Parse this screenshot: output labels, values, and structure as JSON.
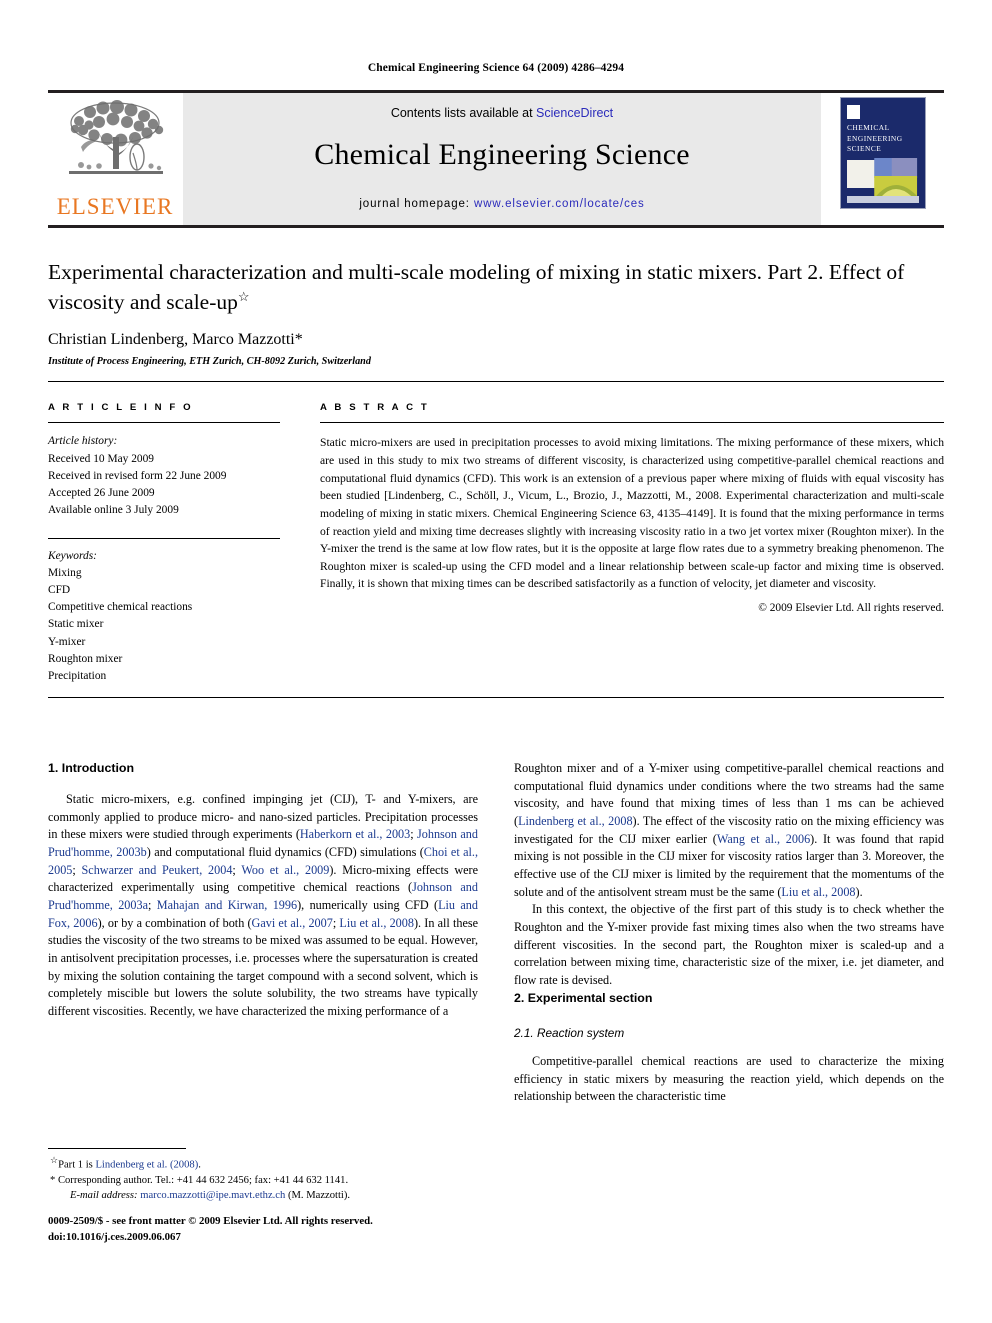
{
  "running_head": "Chemical Engineering Science 64 (2009) 4286–4294",
  "masthead": {
    "contents_prefix": "Contents lists available at ",
    "sciencedirect": "ScienceDirect",
    "journal_title": "Chemical Engineering Science",
    "homepage_prefix": "journal homepage: ",
    "homepage_url": "www.elsevier.com/locate/ces",
    "publisher_wordmark": "ELSEVIER",
    "cover_title_lines": [
      "CHEMICAL",
      "ENGINEERING",
      "SCIENCE"
    ],
    "accent_orange": "#e87722",
    "link_blue": "#2b2bbb",
    "cover_navy": "#1b2a6b"
  },
  "title_block": {
    "title": "Experimental characterization and multi-scale modeling of mixing in static mixers. Part 2. Effect of viscosity and scale-up",
    "title_footnote_marker": "☆",
    "authors": "Christian Lindenberg, Marco Mazzotti*",
    "affiliation": "Institute of Process Engineering, ETH Zurich, CH-8092 Zurich, Switzerland"
  },
  "article_info": {
    "section_label": "A R T I C L E   I N F O",
    "history_head": "Article history:",
    "history": [
      "Received 10 May 2009",
      "Received in revised form 22 June 2009",
      "Accepted 26 June 2009",
      "Available online 3 July 2009"
    ],
    "keywords_head": "Keywords:",
    "keywords": [
      "Mixing",
      "CFD",
      "Competitive chemical reactions",
      "Static mixer",
      "Y-mixer",
      "Roughton mixer",
      "Precipitation"
    ]
  },
  "abstract": {
    "section_label": "A B S T R A C T",
    "text": "Static micro-mixers are used in precipitation processes to avoid mixing limitations. The mixing performance of these mixers, which are used in this study to mix two streams of different viscosity, is characterized using competitive-parallel chemical reactions and computational fluid dynamics (CFD). This work is an extension of a previous paper where mixing of fluids with equal viscosity has been studied [Lindenberg, C., Schöll, J., Vicum, L., Brozio, J., Mazzotti, M., 2008. Experimental characterization and multi-scale modeling of mixing in static mixers. Chemical Engineering Science 63, 4135–4149]. It is found that the mixing performance in terms of reaction yield and mixing time decreases slightly with increasing viscosity ratio in a two jet vortex mixer (Roughton mixer). In the Y-mixer the trend is the same at low flow rates, but it is the opposite at large flow rates due to a symmetry breaking phenomenon. The Roughton mixer is scaled-up using the CFD model and a linear relationship between scale-up factor and mixing time is observed. Finally, it is shown that mixing times can be described satisfactorily as a function of velocity, jet diameter and viscosity.",
    "copyright": "© 2009 Elsevier Ltd. All rights reserved."
  },
  "body": {
    "left_column": {
      "heading": "1. Introduction",
      "paragraph_parts": [
        {
          "t": "Static micro-mixers, e.g. confined impinging jet (CIJ), T- and Y-mixers, are commonly applied to produce micro- and nano-sized particles. Precipitation processes in these mixers were studied through experiments ("
        },
        {
          "t": "Haberkorn et al., 2003",
          "ref": true
        },
        {
          "t": "; "
        },
        {
          "t": "Johnson and Prud'homme, 2003b",
          "ref": true
        },
        {
          "t": ") and computational fluid dynamics (CFD) simulations ("
        },
        {
          "t": "Choi et al., 2005",
          "ref": true
        },
        {
          "t": "; "
        },
        {
          "t": "Schwarzer and Peukert, 2004",
          "ref": true
        },
        {
          "t": "; "
        },
        {
          "t": "Woo et al., 2009",
          "ref": true
        },
        {
          "t": "). Micro-mixing effects were characterized experimentally using competitive chemical reactions ("
        },
        {
          "t": "Johnson and Prud'homme, 2003a",
          "ref": true
        },
        {
          "t": "; "
        },
        {
          "t": "Mahajan and Kirwan, 1996",
          "ref": true
        },
        {
          "t": "), numerically using CFD ("
        },
        {
          "t": "Liu and Fox, 2006",
          "ref": true
        },
        {
          "t": "), or by a combination of both ("
        },
        {
          "t": "Gavi et al., 2007",
          "ref": true
        },
        {
          "t": "; "
        },
        {
          "t": "Liu et al., 2008",
          "ref": true
        },
        {
          "t": "). In all these studies the viscosity of the two streams to be mixed was assumed to be equal. However, in antisolvent precipitation processes, i.e. processes where the supersaturation is created by mixing the solution containing the target compound with a second solvent, which is completely miscible but lowers the solute solubility, the two streams have typically different viscosities. Recently, we have characterized the mixing performance of a"
        }
      ]
    },
    "right_column": {
      "paragraph1_parts": [
        {
          "t": "Roughton mixer and of a Y-mixer using competitive-parallel chemical reactions and computational fluid dynamics under conditions where the two streams had the same viscosity, and have found that mixing times of less than 1 ms can be achieved ("
        },
        {
          "t": "Lindenberg et al., 2008",
          "ref": true
        },
        {
          "t": "). The effect of the viscosity ratio on the mixing efficiency was investigated for the CIJ mixer earlier ("
        },
        {
          "t": "Wang et al., 2006",
          "ref": true
        },
        {
          "t": "). It was found that rapid mixing is not possible in the CIJ mixer for viscosity ratios larger than 3. Moreover, the effective use of the CIJ mixer is limited by the requirement that the momentums of the solute and of the antisolvent stream must be the same ("
        },
        {
          "t": "Liu et al., 2008",
          "ref": true
        },
        {
          "t": ")."
        }
      ],
      "paragraph2": "In this context, the objective of the first part of this study is to check whether the Roughton and the Y-mixer provide fast mixing times also when the two streams have different viscosities. In the second part, the Roughton mixer is scaled-up and a correlation between mixing time, characteristic size of the mixer, i.e. jet diameter, and flow rate is devised.",
      "heading2": "2. Experimental section",
      "subheading21": "2.1. Reaction system",
      "paragraph3": "Competitive-parallel chemical reactions are used to characterize the mixing efficiency in static mixers by measuring the reaction yield, which depends on the relationship between the characteristic time"
    }
  },
  "footnotes": {
    "part1_marker": "☆",
    "part1_prefix": "Part 1 is ",
    "part1_ref": "Lindenberg et al. (2008)",
    "part1_suffix": ".",
    "corresponding_marker": "*",
    "corresponding": " Corresponding author. Tel.: +41 44 632 2456; fax: +41 44 632 1141.",
    "email_label": "E-mail address:",
    "email_address": "marco.mazzotti@ipe.mavt.ethz.ch",
    "email_owner": "(M. Mazzotti)."
  },
  "issn_footer": {
    "line1": "0009-2509/$ - see front matter © 2009 Elsevier Ltd. All rights reserved.",
    "line2": "doi:10.1016/j.ces.2009.06.067"
  }
}
